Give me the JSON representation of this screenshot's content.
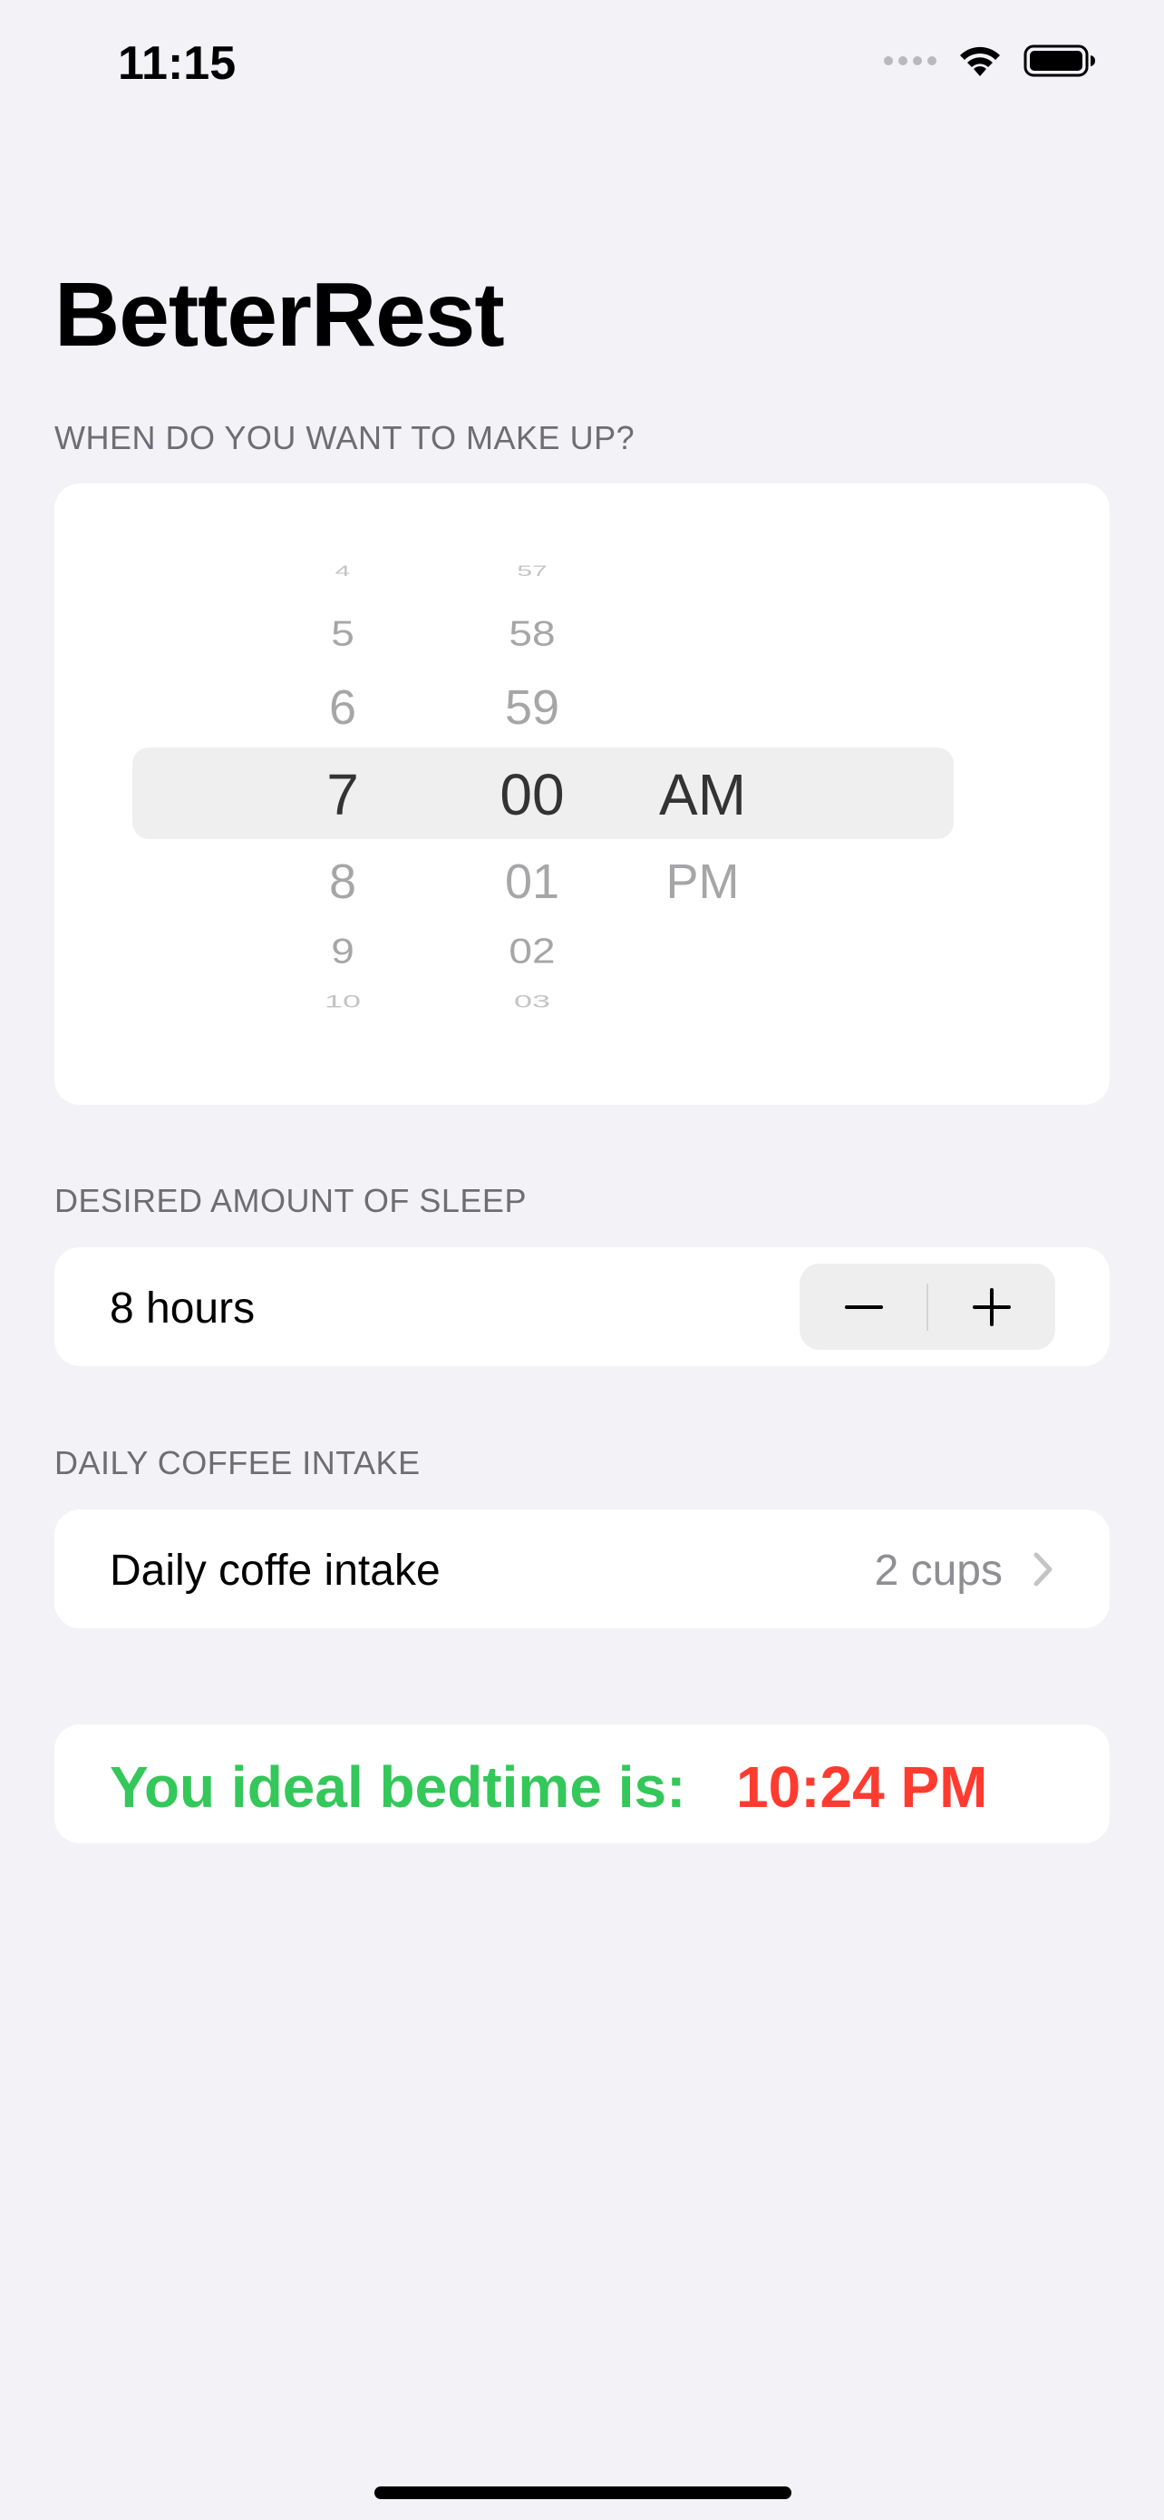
{
  "status_bar": {
    "time": "11:15"
  },
  "title": "BetterRest",
  "wake_section": {
    "header": "WHEN DO YOU WANT TO MAKE UP?",
    "picker": {
      "hours": [
        "4",
        "5",
        "6",
        "7",
        "8",
        "9",
        "10"
      ],
      "minutes": [
        "57",
        "58",
        "59",
        "00",
        "01",
        "02",
        "03"
      ],
      "periods": [
        "AM",
        "PM"
      ],
      "selected_hour": "7",
      "selected_minute": "00",
      "selected_period": "AM"
    }
  },
  "sleep_section": {
    "header": "DESIRED AMOUNT OF SLEEP",
    "value_label": "8 hours"
  },
  "coffee_section": {
    "header": "DAILY COFFEE INTAKE",
    "row_label": "Daily coffe intake",
    "value": "2 cups"
  },
  "result": {
    "label": "You ideal bedtime is:",
    "time": "10:24 PM"
  },
  "colors": {
    "background": "#f2f2f7",
    "green": "#34c759",
    "red": "#ff3b30",
    "secondary_text": "#6d6d72"
  },
  "icons": {
    "wifi": "wifi-icon",
    "battery": "battery-icon",
    "cellular": "cellular-signal-icon",
    "chevron": "chevron-right-icon",
    "minus": "minus-icon",
    "plus": "plus-icon"
  }
}
